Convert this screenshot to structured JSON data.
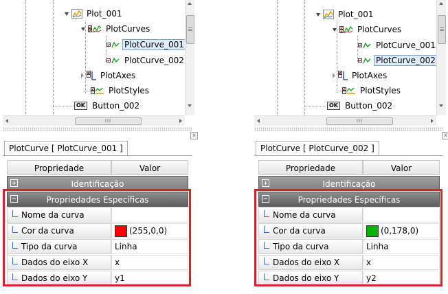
{
  "panels": [
    {
      "id": "left",
      "tree": {
        "plot": "Plot_001",
        "plotcurves": "PlotCurves",
        "curve1": "PlotCurve_001",
        "curve2": "PlotCurve_002",
        "plotaxes": "PlotAxes",
        "plotstyles": "PlotStyles",
        "button": "Button_002",
        "ok_icon_text": "OK",
        "selected": "curve1"
      },
      "hscroll_grip": "III",
      "close_glyph": "x",
      "tab_label": "PlotCurve [ PlotCurve_001 ]",
      "grid": {
        "header_property": "Propriedade",
        "header_value": "Valor",
        "cat_identificacao": "Identificação",
        "cat_especificas": "Propriedades Específicas",
        "rows": [
          {
            "name": "Nome da curva",
            "value": ""
          },
          {
            "name": "Cor da curva",
            "value": "(255,0,0)",
            "swatch": "#ff0000"
          },
          {
            "name": "Tipo da curva",
            "value": "Linha"
          },
          {
            "name": "Dados do eixo X",
            "value": "x"
          },
          {
            "name": "Dados do eixo Y",
            "value": "y1"
          }
        ]
      }
    },
    {
      "id": "right",
      "tree": {
        "plot": "Plot_001",
        "plotcurves": "PlotCurves",
        "curve1": "PlotCurve_001",
        "curve2": "PlotCurve_002",
        "plotaxes": "PlotAxes",
        "plotstyles": "PlotStyles",
        "button": "Button_002",
        "ok_icon_text": "OK",
        "selected": "curve2"
      },
      "hscroll_grip": "III",
      "close_glyph": "x",
      "tab_label": "PlotCurve [ PlotCurve_002 ]",
      "grid": {
        "header_property": "Propriedade",
        "header_value": "Valor",
        "cat_identificacao": "Identificação",
        "cat_especificas": "Propriedades Específicas",
        "rows": [
          {
            "name": "Nome da curva",
            "value": ""
          },
          {
            "name": "Cor da curva",
            "value": "(0,178,0)",
            "swatch": "#00b200"
          },
          {
            "name": "Tipo da curva",
            "value": "Linha"
          },
          {
            "name": "Dados do eixo X",
            "value": "x"
          },
          {
            "name": "Dados do eixo Y",
            "value": "y2"
          }
        ]
      }
    }
  ],
  "colors": {
    "highlight": "#d9232b",
    "selection_fill": "#dfeeff",
    "category_bar": "#6e6e6e"
  }
}
